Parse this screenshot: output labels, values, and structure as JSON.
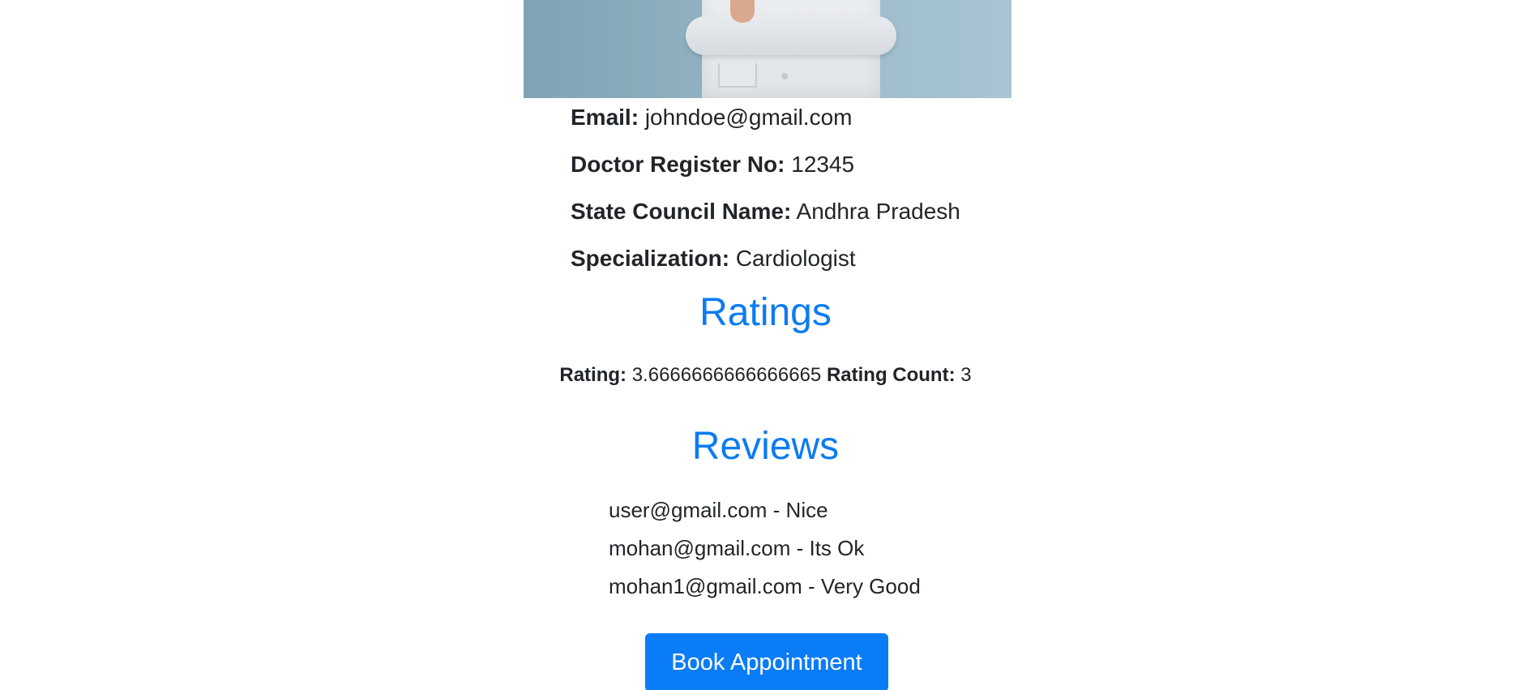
{
  "profile": {
    "email_label": "Email:",
    "email_value": "johndoe@gmail.com",
    "register_label": "Doctor Register No:",
    "register_value": "12345",
    "council_label": "State Council Name:",
    "council_value": "Andhra Pradesh",
    "specialization_label": "Specialization:",
    "specialization_value": "Cardiologist"
  },
  "ratings": {
    "heading": "Ratings",
    "rating_label": "Rating:",
    "rating_value": "3.6666666666666665",
    "count_label": "Rating Count:",
    "count_value": "3"
  },
  "reviews": {
    "heading": "Reviews",
    "items": [
      {
        "text": "user@gmail.com - Nice"
      },
      {
        "text": "mohan@gmail.com - Its Ok"
      },
      {
        "text": "mohan1@gmail.com - Very Good"
      }
    ]
  },
  "actions": {
    "book_label": "Book Appointment"
  },
  "colors": {
    "accent": "#0d7bf1",
    "button": "#0a7cf6",
    "text": "#212529"
  }
}
